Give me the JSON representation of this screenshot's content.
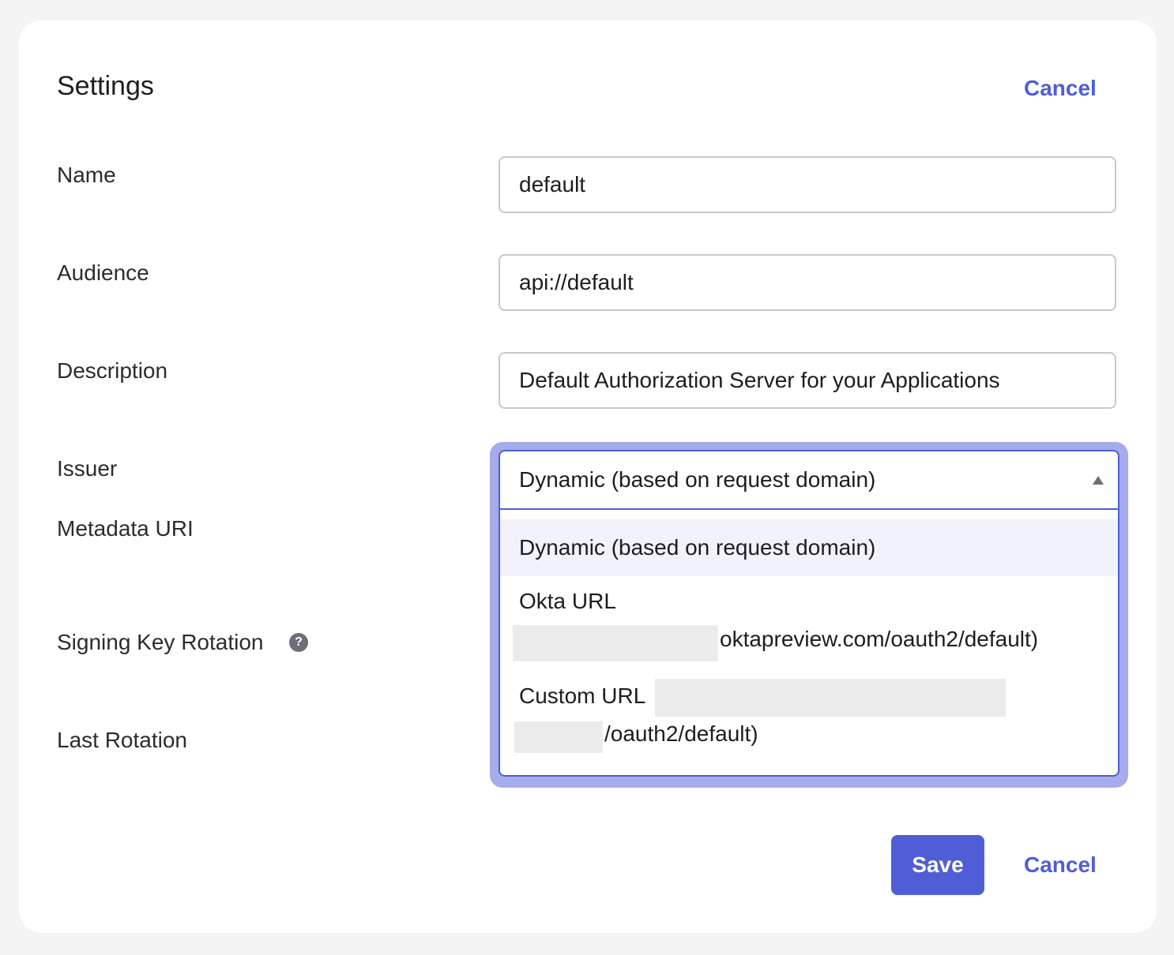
{
  "header": {
    "title": "Settings",
    "cancel_label": "Cancel"
  },
  "fields": {
    "name": {
      "label": "Name",
      "value": "default"
    },
    "audience": {
      "label": "Audience",
      "value": "api://default"
    },
    "description": {
      "label": "Description",
      "value": "Default Authorization Server for your Applications"
    },
    "issuer": {
      "label": "Issuer",
      "selected": "Dynamic (based on request domain)",
      "options": [
        {
          "line1": "Dynamic (based on request domain)"
        },
        {
          "line1": "Okta URL",
          "line2": "oktapreview.com/oauth2/default)"
        },
        {
          "line1": "Custom URL",
          "line2": "/oauth2/default)"
        }
      ]
    },
    "metadata_uri": {
      "label": "Metadata URI"
    },
    "signing_key_rotation": {
      "label": "Signing Key Rotation",
      "help_icon": "?"
    },
    "last_rotation": {
      "label": "Last Rotation"
    }
  },
  "footer": {
    "save_label": "Save",
    "cancel_label": "Cancel"
  },
  "colors": {
    "accent": "#4f5ed6",
    "focus_ring": "#a6abec",
    "highlight": "#f1f2fb"
  }
}
